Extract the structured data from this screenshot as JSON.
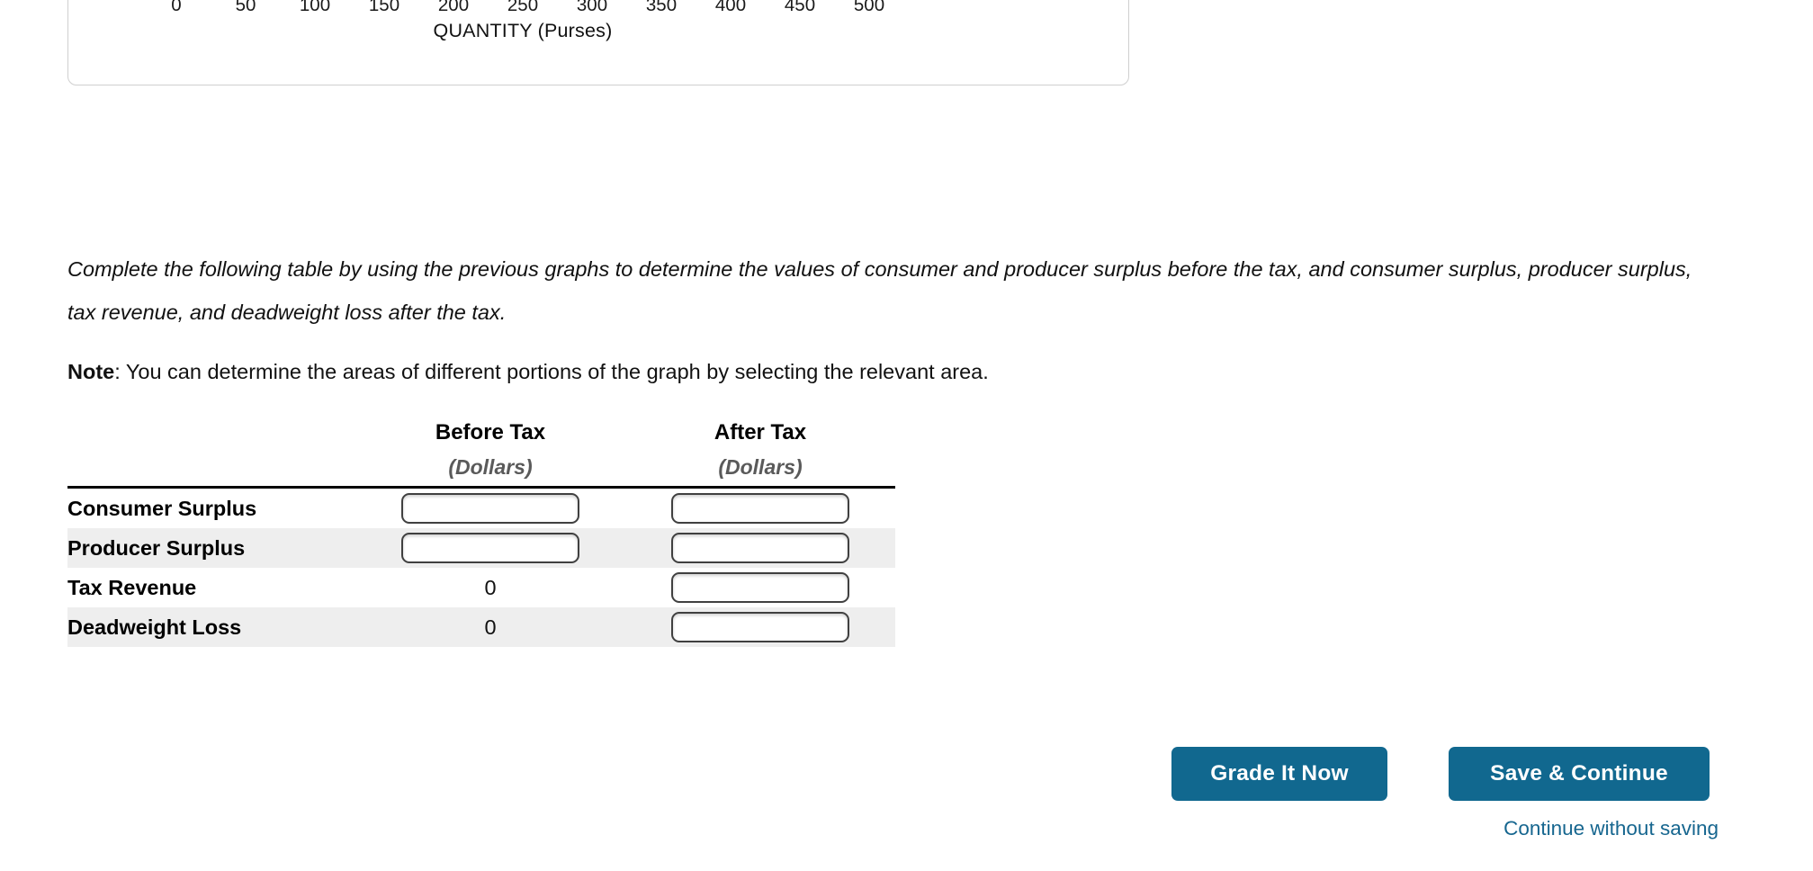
{
  "chart_panel": {
    "axis_title": "QUANTITY (Purses)",
    "ticks": [
      "0",
      "50",
      "100",
      "150",
      "200",
      "250",
      "300",
      "350",
      "400",
      "450",
      "500"
    ]
  },
  "chart_data": {
    "type": "line",
    "title": "",
    "xlabel": "QUANTITY (Purses)",
    "ylabel": "",
    "x_ticks": [
      0,
      50,
      100,
      150,
      200,
      250,
      300,
      350,
      400,
      450,
      500
    ],
    "xlim": [
      0,
      500
    ],
    "grid": false,
    "legend_position": "none",
    "series": []
  },
  "prose": {
    "instruction": "Complete the following table by using the previous graphs to determine the values of consumer and producer surplus before the tax, and consumer surplus, producer surplus, tax revenue, and deadweight loss after the tax.",
    "note_label": "Note",
    "note_text": ": You can determine the areas of different portions of the graph by selecting the relevant area."
  },
  "table": {
    "headers": {
      "blank": "",
      "before_main": "Before Tax",
      "before_unit": "(Dollars)",
      "after_main": "After Tax",
      "after_unit": "(Dollars)"
    },
    "rows": [
      {
        "label": "Consumer Surplus",
        "before": {
          "kind": "input",
          "value": "",
          "placeholder": ""
        },
        "after": {
          "kind": "input",
          "value": "",
          "placeholder": ""
        }
      },
      {
        "label": "Producer Surplus",
        "before": {
          "kind": "input",
          "value": "",
          "placeholder": ""
        },
        "after": {
          "kind": "input",
          "value": "",
          "placeholder": ""
        }
      },
      {
        "label": "Tax Revenue",
        "before": {
          "kind": "text",
          "value": "0"
        },
        "after": {
          "kind": "input",
          "value": "",
          "placeholder": ""
        }
      },
      {
        "label": "Deadweight Loss",
        "before": {
          "kind": "text",
          "value": "0"
        },
        "after": {
          "kind": "input",
          "value": "",
          "placeholder": ""
        }
      }
    ]
  },
  "actions": {
    "grade_label": "Grade It Now",
    "save_label": "Save & Continue",
    "skip_label": "Continue without saving",
    "button_color": "#11688f",
    "link_color": "#16668f"
  }
}
